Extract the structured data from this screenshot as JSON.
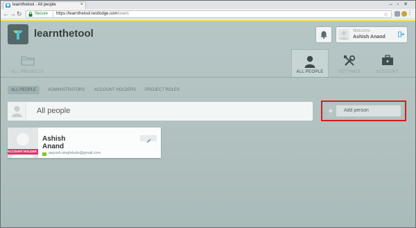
{
  "browser": {
    "tab_title": "learnthetool - All people",
    "secure_label": "Secure",
    "url_host": "https://learnthetool.testlodge.com",
    "url_path": "/users"
  },
  "app": {
    "brand": "learnthetool",
    "user": {
      "welcome": "Welcome",
      "name": "Ashish Anand"
    }
  },
  "main_nav": [
    {
      "label": "ALL PROJECTS",
      "icon": "folder-icon"
    },
    {
      "label": "ALL PEOPLE",
      "icon": "person-icon",
      "active": true
    },
    {
      "label": "SETTINGS",
      "icon": "tools-icon"
    },
    {
      "label": "ACCOUNT",
      "icon": "briefcase-icon"
    }
  ],
  "sub_tabs": [
    {
      "label": "ALL PEOPLE",
      "active": true
    },
    {
      "label": "ADMINISTRATORS"
    },
    {
      "label": "ACCOUNT HOLDERS"
    },
    {
      "label": "PROJECT ROLES"
    }
  ],
  "people_header": {
    "title": "All people"
  },
  "add_person": {
    "label": "Add person"
  },
  "person_card": {
    "first_name": "Ashish",
    "last_name": "Anand",
    "badge": "ACCOUNT HOLDER",
    "email": "aayush.singhdude@gmail.com"
  },
  "colors": {
    "accent_yellow": "#e7d84b",
    "highlight_red": "#d21d1d",
    "badge_pink": "#d63b6b",
    "email_icon_green": "#8cbf26"
  }
}
